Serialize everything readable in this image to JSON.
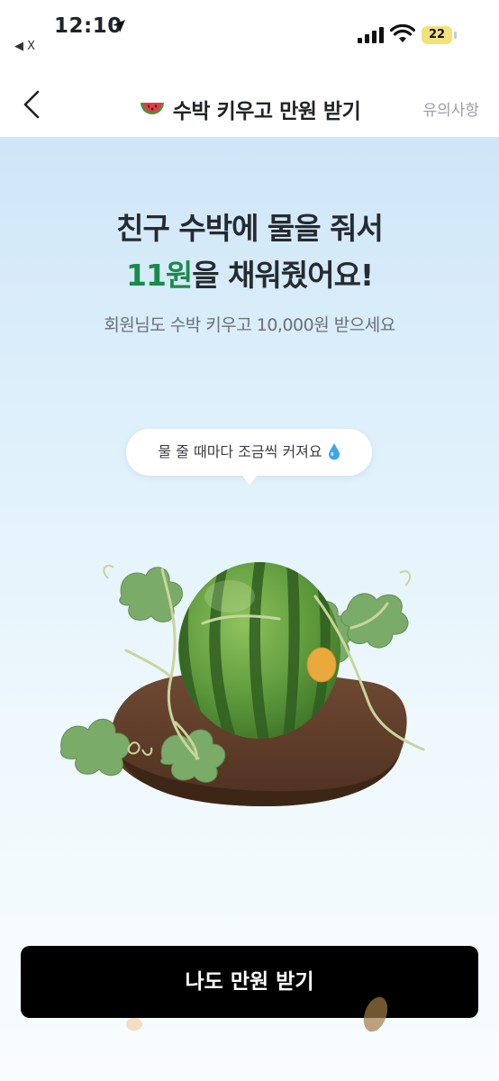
{
  "status": {
    "time": "12:10",
    "back_app": "◀ X",
    "battery": "22"
  },
  "nav": {
    "title": "수박 키우고 만원 받기",
    "notice": "유의사항"
  },
  "main": {
    "headline_line1": "친구 수박에 물을 줘서",
    "headline_amount": "11원",
    "headline_line2_rest": "을 채워줬어요!",
    "subtitle": "회원님도 수박 키우고 10,000원 받으세요",
    "bubble": "물 줄 때마다 조금씩 커져요"
  },
  "cta": {
    "label": "나도 만원 받기"
  },
  "colors": {
    "accent_green": "#1b8a4c",
    "cta_bg": "#000000"
  }
}
